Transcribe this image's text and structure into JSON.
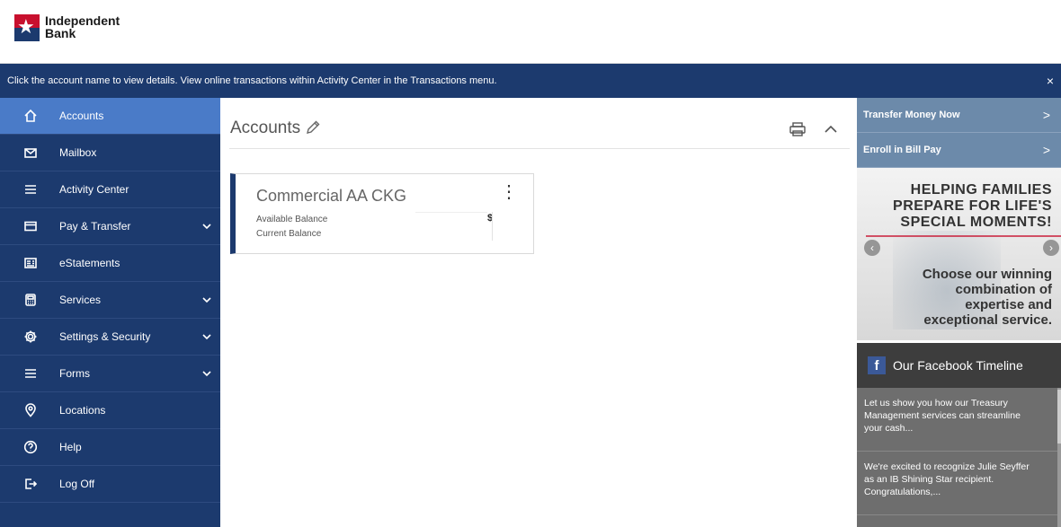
{
  "brand": {
    "name_line1": "Independent",
    "name_line2": "Bank",
    "star": "★"
  },
  "banner": {
    "text": "Click the account name to view details. View online transactions within Activity Center in the Transactions menu.",
    "close": "×"
  },
  "sidebar": {
    "items": [
      {
        "label": "Accounts",
        "icon": "home-icon",
        "active": true
      },
      {
        "label": "Mailbox",
        "icon": "mail-icon"
      },
      {
        "label": "Activity Center",
        "icon": "menu-icon"
      },
      {
        "label": "Pay & Transfer",
        "icon": "card-icon",
        "expandable": true
      },
      {
        "label": "eStatements",
        "icon": "statement-icon"
      },
      {
        "label": "Services",
        "icon": "calculator-icon",
        "expandable": true
      },
      {
        "label": "Settings & Security",
        "icon": "gear-icon",
        "expandable": true
      },
      {
        "label": "Forms",
        "icon": "list-icon",
        "expandable": true
      },
      {
        "label": "Locations",
        "icon": "location-icon"
      },
      {
        "label": "Help",
        "icon": "help-icon"
      },
      {
        "label": "Log Off",
        "icon": "logout-icon"
      }
    ]
  },
  "main": {
    "title": "Accounts",
    "account": {
      "name": "Commercial AA CKG",
      "menu": "⋮",
      "available_label": "Available Balance",
      "current_label": "Current Balance",
      "currency": "$"
    }
  },
  "right": {
    "quick_links": [
      {
        "label": "Transfer Money Now",
        "arrow": ">"
      },
      {
        "label": "Enroll in Bill Pay",
        "arrow": ">"
      }
    ],
    "promo": {
      "line1": "HELPING FAMILIES",
      "line2": "PREPARE FOR LIFE'S",
      "line3": "SPECIAL MOMENTS!",
      "line4": "Choose our winning",
      "line5": "combination of",
      "line6": "expertise and",
      "line7": "exceptional service.",
      "prev": "‹",
      "next": "›"
    },
    "facebook": {
      "icon": "f",
      "title": "Our Facebook Timeline",
      "posts": [
        "Let us show you how our Treasury Management services can streamline your cash...",
        "We're excited to recognize Julie Seyffer as an IB Shining Star recipient. Congratulations,..."
      ]
    }
  },
  "colors": {
    "navy": "#1c3a6e",
    "active": "#4a7bc8",
    "quick": "#6c8aaa",
    "red": "#c8102e"
  }
}
